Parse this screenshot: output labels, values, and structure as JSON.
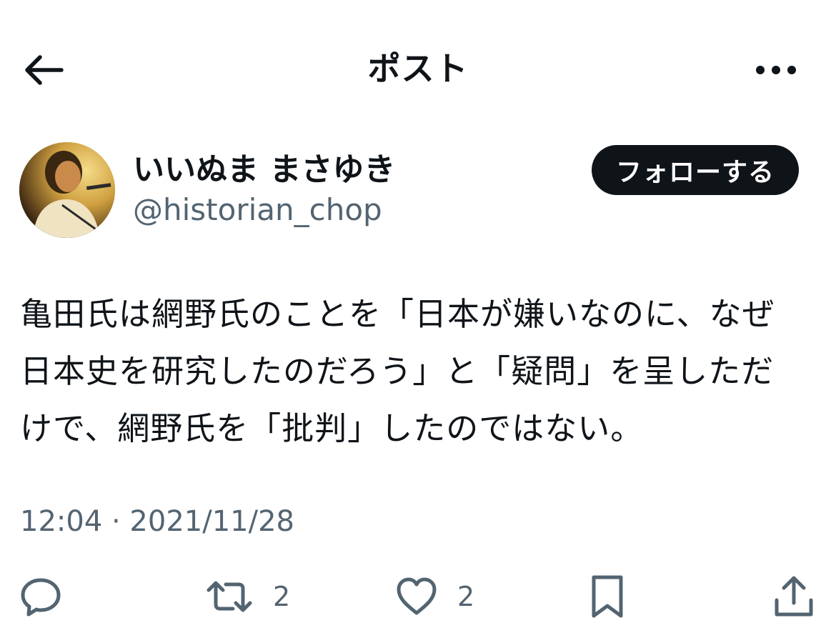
{
  "header": {
    "title": "ポスト",
    "back_icon": "arrow-left-icon",
    "more_icon": "more-horizontal-icon"
  },
  "author": {
    "name": "いいぬま まさゆき",
    "handle": "@historian_chop",
    "follow_label": "フォローする"
  },
  "post": {
    "lines": [
      "亀田氏は網野氏のことを「日本が嫌いなのに、なぜ",
      "日本史を研究したのだろう」と「疑問」を呈しただ",
      "けで、網野氏を「批判」したのではない。"
    ],
    "timestamp": "12:04 · 2021/11/28"
  },
  "actions": {
    "reply_icon": "reply-icon",
    "retweet_icon": "retweet-icon",
    "retweet_count": "2",
    "like_icon": "heart-icon",
    "like_count": "2",
    "bookmark_icon": "bookmark-icon",
    "share_icon": "share-icon"
  },
  "colors": {
    "text_primary": "#0f1419",
    "text_secondary": "#536471",
    "follow_button_bg": "#0f1419",
    "follow_button_text": "#ffffff"
  }
}
